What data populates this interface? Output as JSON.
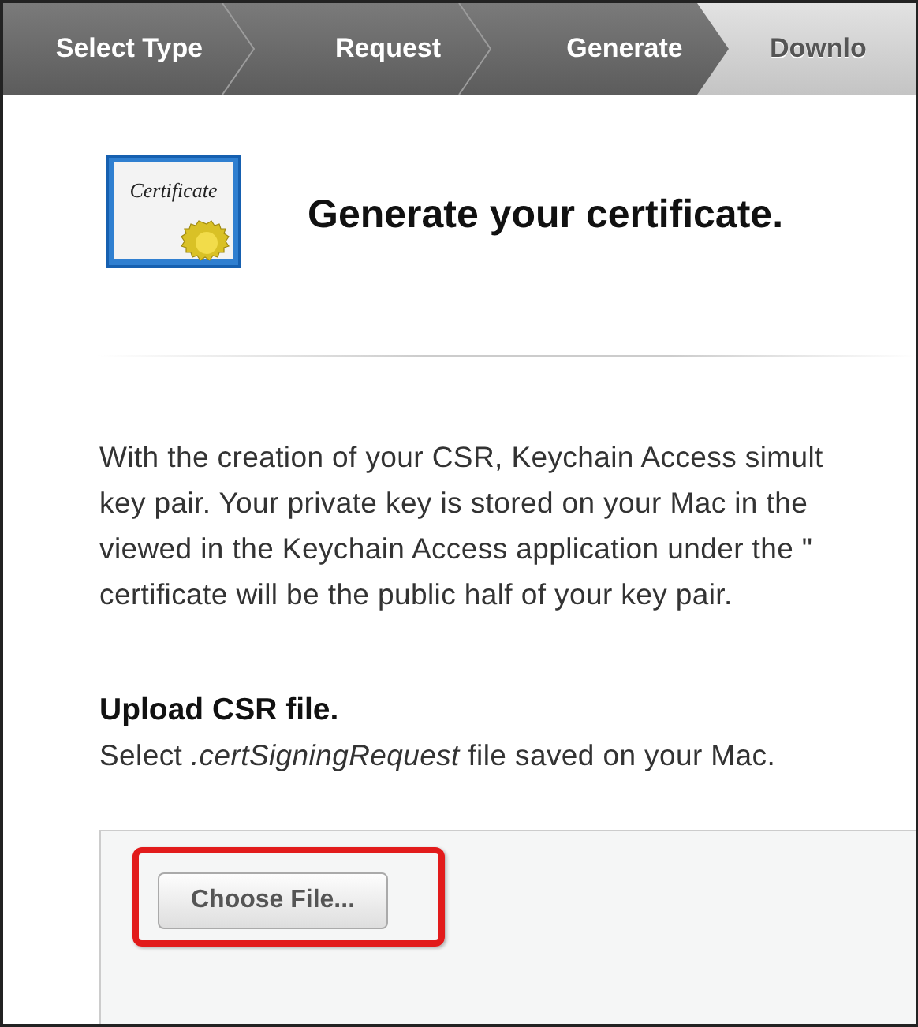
{
  "steps": [
    {
      "label": "Select Type",
      "selected": false
    },
    {
      "label": "Request",
      "selected": false
    },
    {
      "label": "Generate",
      "selected": false
    },
    {
      "label": "Downlo",
      "selected": true
    }
  ],
  "header": {
    "icon_text": "Certificate",
    "title": "Generate your certificate."
  },
  "description": [
    "With the creation of your CSR, Keychain Access simult",
    "key pair. Your private key is stored on your Mac in the",
    "viewed in the Keychain Access application under the \"",
    "certificate will be the public half of your key pair."
  ],
  "upload": {
    "title": "Upload CSR file.",
    "hint": "Select *.certSigningRequest* file saved on your Mac.",
    "button": "Choose File..."
  }
}
